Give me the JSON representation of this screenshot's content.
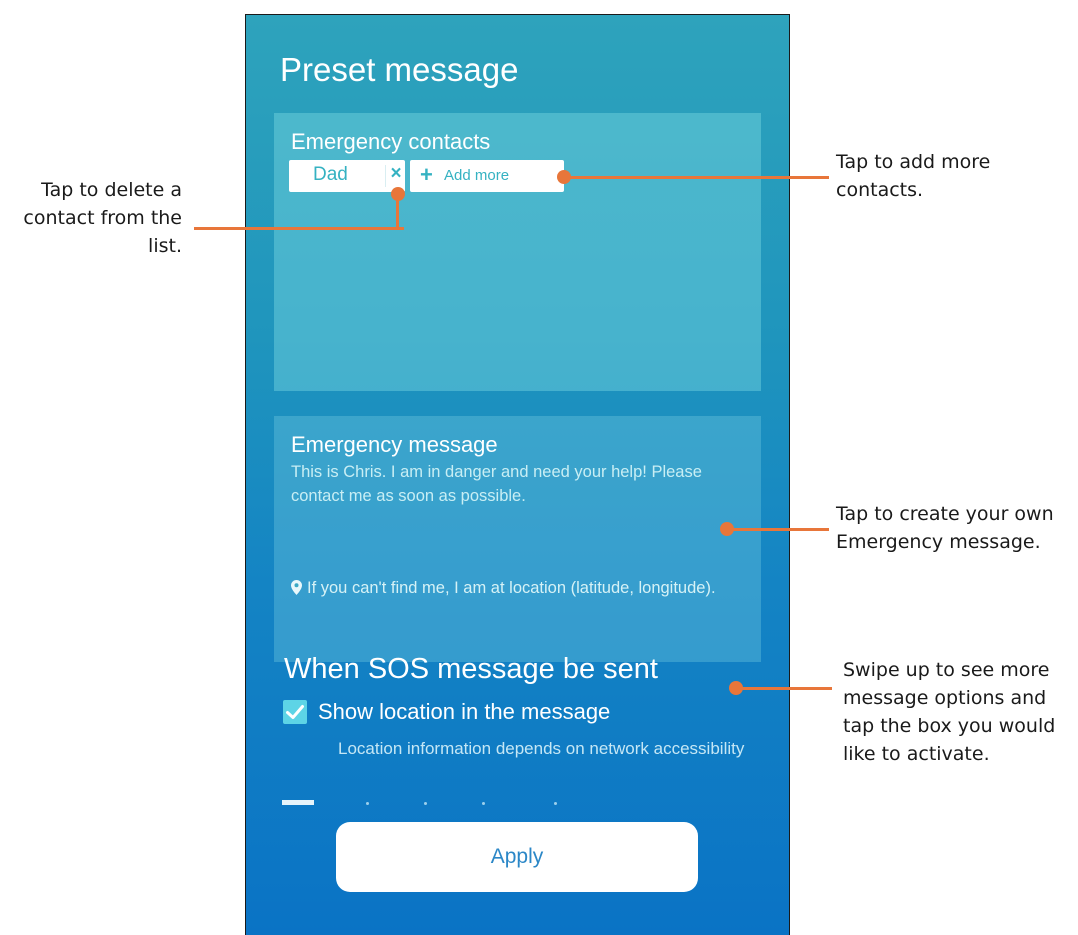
{
  "screen": {
    "title": "Preset message",
    "contacts": {
      "heading": "Emergency contacts",
      "chips": [
        {
          "label": "Dad",
          "delete_icon": "×"
        }
      ],
      "add_more": {
        "icon": "+",
        "label": "Add more"
      }
    },
    "message": {
      "heading": "Emergency message",
      "body": "This is Chris. I am in danger and need your help! Please contact me as soon as possible.",
      "location_line": "If you can't find me, I am at location (latitude, longitude).",
      "location_icon": "map-pin-icon"
    },
    "sos_section": {
      "heading": "When SOS message be sent",
      "option_label": "Show location in the message",
      "option_checked": true,
      "option_note": "Location information depends on network accessibility"
    },
    "apply_label": "Apply"
  },
  "callouts": {
    "delete_contact": [
      "Tap to delete a",
      "contact from the",
      "list."
    ],
    "add_contacts": [
      "Tap to add more",
      "contacts."
    ],
    "create_message": [
      "Tap to create your own",
      "Emergency message."
    ],
    "swipe_options": [
      "Swipe up to see more",
      "message options and",
      "tap the box you would",
      "like to activate."
    ]
  },
  "colors": {
    "callout_accent": "#e8763a",
    "chip_text": "#35b2c2",
    "apply_text": "#2b87c7",
    "screen_top": "#2ea3bc",
    "screen_bottom": "#0a73c5"
  }
}
